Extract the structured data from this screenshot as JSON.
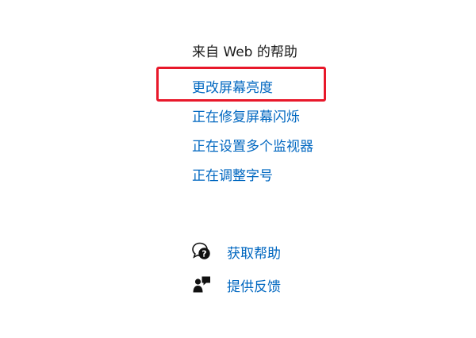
{
  "help_from_web": {
    "title": "来自 Web 的帮助",
    "links": [
      {
        "label": "更改屏幕亮度"
      },
      {
        "label": "正在修复屏幕闪烁"
      },
      {
        "label": "正在设置多个监视器"
      },
      {
        "label": "正在调整字号"
      }
    ]
  },
  "actions": {
    "get_help": {
      "label": "获取帮助",
      "icon": "get-help-icon"
    },
    "give_feedback": {
      "label": "提供反馈",
      "icon": "feedback-icon"
    }
  },
  "highlight": {
    "target": "更改屏幕亮度",
    "color": "#e8182a"
  },
  "colors": {
    "link": "#0067c0",
    "text": "#1b1b1b"
  }
}
